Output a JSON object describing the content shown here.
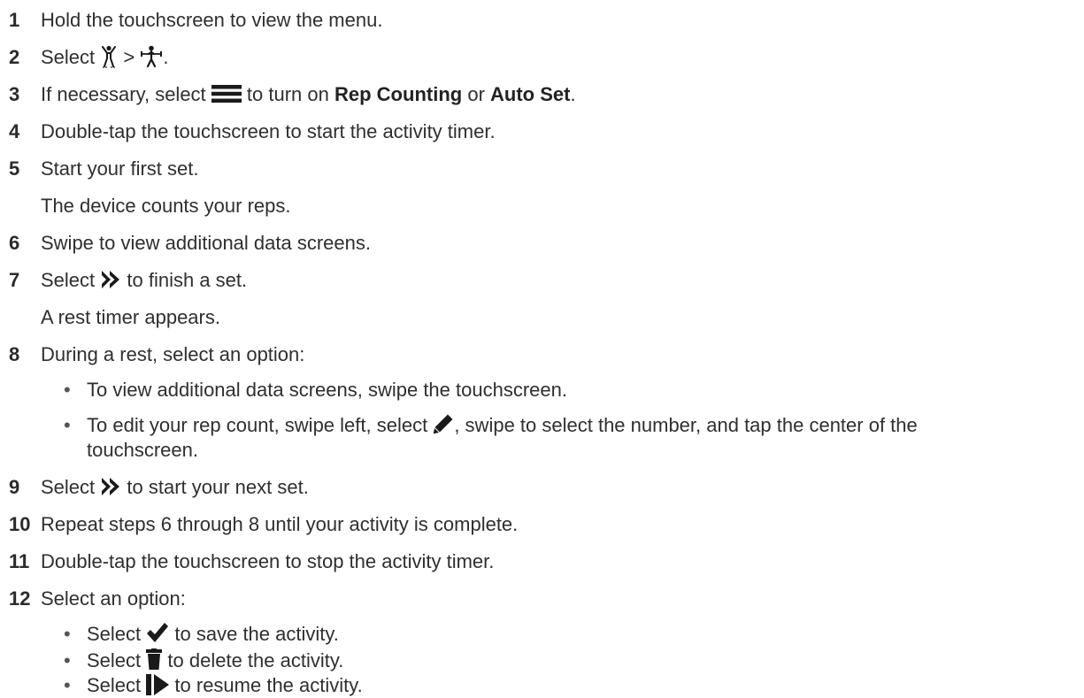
{
  "steps": [
    {
      "num": "1",
      "text": "Hold the touchscreen to view the menu."
    },
    {
      "num": "2",
      "pre": "Select",
      "sep": ">",
      "post": ".",
      "icon1": "strength-figure-icon",
      "icon2": "weightlifting-icon"
    },
    {
      "num": "3",
      "pre": "If necessary, select",
      "mid": "to turn on",
      "bold1": "Rep Counting",
      "or": "or",
      "bold2": "Auto Set",
      "post": ".",
      "icon": "menu-icon"
    },
    {
      "num": "4",
      "text": "Double-tap the touchscreen to start the activity timer."
    },
    {
      "num": "5",
      "text": "Start your first set.",
      "cont": "The device counts your reps."
    },
    {
      "num": "6",
      "text": "Swipe to view additional data screens."
    },
    {
      "num": "7",
      "pre": "Select",
      "post": "to finish a set.",
      "cont": "A rest timer appears.",
      "icon": "double-chevron-icon"
    },
    {
      "num": "8",
      "text": "During a rest, select an option:"
    },
    {
      "num": "9",
      "pre": "Select",
      "post": "to start your next set.",
      "icon": "double-chevron-icon"
    },
    {
      "num": "10",
      "text": "Repeat steps 6 through 8 until your activity is complete."
    },
    {
      "num": "11",
      "text": "Double-tap the touchscreen to stop the activity timer."
    },
    {
      "num": "12",
      "text": "Select an option:"
    }
  ],
  "step8_bullets": {
    "b1": "To view additional data screens, swipe the touchscreen.",
    "b2_pre": "To edit your rep count, swipe left, select",
    "b2_post": ", swipe to select the number, and tap the center of the",
    "b2_wrap": "touchscreen."
  },
  "step12_bullets": [
    {
      "pre": "Select",
      "post": "to save the activity.",
      "icon": "checkmark-icon"
    },
    {
      "pre": "Select",
      "post": "to delete the activity.",
      "icon": "trash-icon"
    },
    {
      "pre": "Select",
      "post": "to resume the activity.",
      "icon": "resume-icon"
    }
  ],
  "bullet_char": "•",
  "colors": {
    "text": "#2f2f2f",
    "number": "#2b2b2b",
    "icon": "#1a1a1a"
  }
}
